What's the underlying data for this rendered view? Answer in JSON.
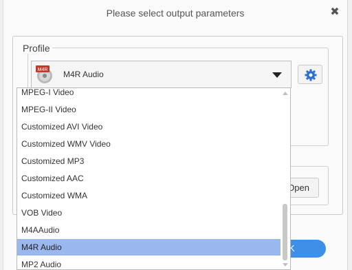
{
  "dialog": {
    "title": "Please select output parameters",
    "close_glyph": "✖"
  },
  "profile": {
    "legend": "Profile",
    "selected_value": "M4R Audio",
    "icon_badge": "M4R",
    "icon": "m4r-audio-disc-icon"
  },
  "buttons": {
    "settings_icon": "gear-icon",
    "open_label": "Open",
    "ok_label": "K"
  },
  "dropdown": {
    "items": [
      "MPEG-I Video",
      "MPEG-II Video",
      "Customized AVI Video",
      "Customized WMV Video",
      "Customized MP3",
      "Customized AAC",
      "Customized WMA",
      "VOB Video",
      "M4AAudio",
      "M4R Audio",
      "MP2 Audio"
    ],
    "selected_index": 9
  },
  "colors": {
    "selection_highlight": "#9ab7ee",
    "accent": "#3d8fe8",
    "gear": "#2f6fcf"
  }
}
